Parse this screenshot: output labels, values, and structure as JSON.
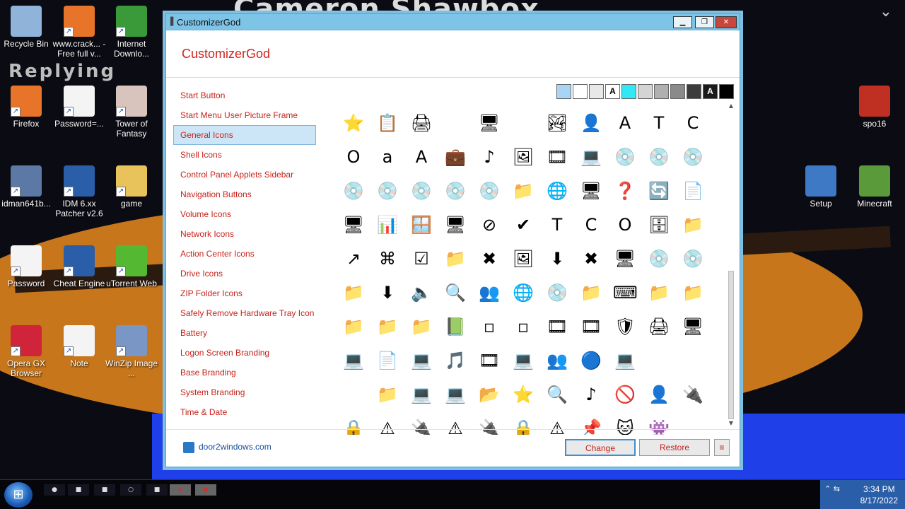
{
  "desktop": {
    "wallpaper_title": "Cameron Shawbox",
    "wallpaper_text": "Replying",
    "icons": [
      {
        "label": "Recycle Bin",
        "icon": "recycle-bin-icon",
        "color": "#8fb3d9"
      },
      {
        "label": "www.crack... - Free full v...",
        "icon": "firefox-icon",
        "color": "#e8742a"
      },
      {
        "label": "Internet Downlo...",
        "icon": "internet-download-icon",
        "color": "#3a9a3a"
      },
      {
        "label": "Firefox",
        "icon": "firefox-icon",
        "color": "#e8742a"
      },
      {
        "label": "Password=...",
        "icon": "document-icon",
        "color": "#f4f4f4"
      },
      {
        "label": "Tower of Fantasy",
        "icon": "game-icon",
        "color": "#d8c4bd"
      },
      {
        "label": "idman641b...",
        "icon": "installer-icon",
        "color": "#5c79a5"
      },
      {
        "label": "IDM 6.xx Patcher v2.6",
        "icon": "patcher-icon",
        "color": "#2a5ea8"
      },
      {
        "label": "game",
        "icon": "folder-icon",
        "color": "#e8c25a"
      },
      {
        "label": "Password",
        "icon": "document-icon",
        "color": "#f4f4f4"
      },
      {
        "label": "Cheat Engine",
        "icon": "gear-icon",
        "color": "#2a5ea8"
      },
      {
        "label": "uTorrent Web",
        "icon": "utorrent-icon",
        "color": "#55b833"
      },
      {
        "label": "Opera GX Browser",
        "icon": "opera-icon",
        "color": "#d0243a"
      },
      {
        "label": "Note",
        "icon": "document-icon",
        "color": "#f4f4f4"
      },
      {
        "label": "WinZip Image ...",
        "icon": "winzip-icon",
        "color": "#7a96c4"
      },
      {
        "label": "spo16",
        "icon": "spo16-icon",
        "color": "#c03022"
      },
      {
        "label": "Setup",
        "icon": "setup-icon",
        "color": "#3d79c4"
      },
      {
        "label": "Minecraft",
        "icon": "minecraft-icon",
        "color": "#5a9a3a"
      }
    ]
  },
  "window": {
    "title": "CustomizerGod",
    "app_name": "CustomizerGod",
    "controls": {
      "minimize": "▁",
      "maximize": "❐",
      "close": "✕"
    },
    "menu": [
      "Start Button",
      "Start Menu User Picture Frame",
      "General Icons",
      "Shell Icons",
      "Control Panel Applets Sidebar",
      "Navigation Buttons",
      "Volume Icons",
      "Network Icons",
      "Action Center Icons",
      "Drive Icons",
      "ZIP Folder Icons",
      "Safely Remove Hardware Tray Icon",
      "Battery",
      "Logon Screen Branding",
      "Base Branding",
      "System Branding",
      "Time & Date"
    ],
    "selected_menu": "General Icons",
    "swatches": [
      {
        "color": "#a8d4f5",
        "text": ""
      },
      {
        "color": "#ffffff",
        "text": ""
      },
      {
        "color": "#e8e8e8",
        "text": ""
      },
      {
        "color": "#ffffff",
        "text": "A"
      },
      {
        "color": "#33e8f5",
        "text": ""
      },
      {
        "color": "#d4d4d4",
        "text": ""
      },
      {
        "color": "#b0b0b0",
        "text": ""
      },
      {
        "color": "#8a8a8a",
        "text": ""
      },
      {
        "color": "#3c3c3c",
        "text": ""
      },
      {
        "color": "#1a1a1a",
        "text": "A"
      },
      {
        "color": "#000000",
        "text": ""
      }
    ],
    "icon_rows": [
      [
        "⭐",
        "📋",
        "🖨",
        "",
        "🖥",
        "",
        "🏞",
        "👤",
        "A",
        "T",
        "C"
      ],
      [
        "O",
        "a",
        "A",
        "💼",
        "♪",
        "🖼",
        "🎞",
        "💻",
        "💿",
        "💿",
        "💿"
      ],
      [
        "💿",
        "💿",
        "💿",
        "💿",
        "💿",
        "📁",
        "🌐",
        "🖥",
        "❓",
        "🔄",
        "📄"
      ],
      [
        "🖥",
        "📊",
        "🪟",
        "🖥",
        "⊘",
        "✔",
        "T",
        "C",
        "O",
        "🗄",
        "📁"
      ],
      [
        "↗",
        "⌘",
        "☑",
        "📁",
        "✖",
        "🖼",
        "⬇",
        "✖",
        "🖥",
        "💿",
        "💿"
      ],
      [
        "📁",
        "⬇",
        "🔈",
        "🔍",
        "👥",
        "🌐",
        "💿",
        "📁",
        "⌨",
        "📁",
        "📁"
      ],
      [
        "📁",
        "📁",
        "📁",
        "📗",
        "▫",
        "▫",
        "🎞",
        "🎞",
        "🛡",
        "🖨",
        "🖥"
      ],
      [
        "💻",
        "📄",
        "💻",
        "🎵",
        "🎞",
        "💻",
        "👥",
        "🔵",
        "💻",
        "",
        ""
      ],
      [
        "",
        "📁",
        "💻",
        "💻",
        "📂",
        "⭐",
        "🔍",
        "♪",
        "🚫",
        "👤",
        "🔌"
      ],
      [
        "🔒",
        "⚠",
        "🔌",
        "⚠",
        "🔌",
        "🔒",
        "⚠",
        "📌",
        "🐱",
        "👾",
        ""
      ]
    ],
    "footer_link": "door2windows.com",
    "buttons": {
      "change": "Change",
      "restore": "Restore",
      "menu": "≡"
    }
  },
  "taskbar": {
    "items": [
      "●",
      "■",
      "■",
      "○",
      "■",
      "▪",
      "●"
    ],
    "time": "3:34 PM",
    "date": "8/17/2022"
  }
}
